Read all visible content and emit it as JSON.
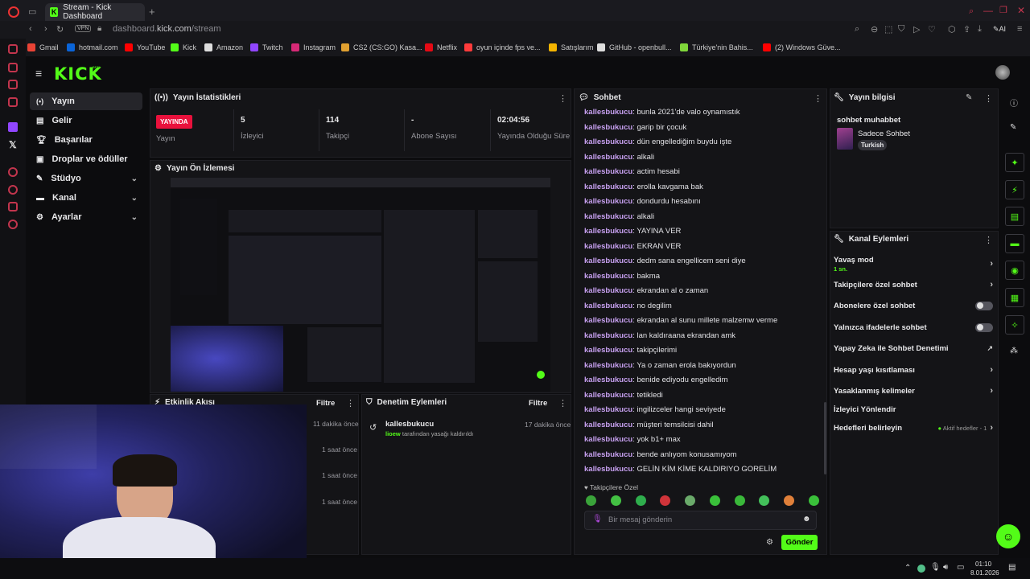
{
  "browser": {
    "tab_title": "Stream - Kick Dashboard",
    "vpn_label": "VPN",
    "url_prefix": "dashboard.",
    "url_domain": "kick.com",
    "url_path": "/stream",
    "ai_label": "AI",
    "bookmarks": [
      {
        "label": "Gmail",
        "color": "#ea4335"
      },
      {
        "label": "hotmail.com",
        "color": "#0a64d8"
      },
      {
        "label": "YouTube",
        "color": "#ff0000"
      },
      {
        "label": "Kick",
        "color": "#53fc18"
      },
      {
        "label": "Amazon",
        "color": "#dddddd"
      },
      {
        "label": "Twitch",
        "color": "#9146ff"
      },
      {
        "label": "Instagram",
        "color": "#d62976"
      },
      {
        "label": "CS2 (CS:GO) Kasa...",
        "color": "#e0a030"
      },
      {
        "label": "Netflix",
        "color": "#e50914"
      },
      {
        "label": "oyun içinde fps ve...",
        "color": "#ff3b3b"
      },
      {
        "label": "Satışlarım",
        "color": "#f4b400"
      },
      {
        "label": "GitHub - openbull...",
        "color": "#dddddd"
      },
      {
        "label": "Türkiye'nin Bahis...",
        "color": "#7fd63a"
      },
      {
        "label": "(2) Windows Güve...",
        "color": "#ff0000"
      }
    ]
  },
  "brand": {
    "logo": "KICK",
    "beta": "BETA"
  },
  "nav": [
    {
      "label": "Yayın"
    },
    {
      "label": "Gelir"
    },
    {
      "label": "Başarılar"
    },
    {
      "label": "Droplar ve ödüller"
    },
    {
      "label": "Stüdyo"
    },
    {
      "label": "Kanal"
    },
    {
      "label": "Ayarlar"
    }
  ],
  "stats": {
    "title": "Yayın İstatistikleri",
    "live_badge": "YAYINDA",
    "live_label": "Yayın",
    "items": [
      {
        "value": "5",
        "label": "İzleyici"
      },
      {
        "value": "114",
        "label": "Takipçi"
      },
      {
        "value": "-",
        "label": "Abone Sayısı"
      },
      {
        "value": "02:04:56",
        "label": "Yayında Olduğu Süre"
      }
    ]
  },
  "preview": {
    "title": "Yayın Ön İzlemesi"
  },
  "activity": {
    "title": "Etkinlik Akışı",
    "filter": "Filtre",
    "times": [
      "11 dakika önce",
      "1 saat önce",
      "1 saat önce",
      "1 saat önce"
    ]
  },
  "mod": {
    "title": "Denetim Eylemleri",
    "filter": "Filtre",
    "entry": {
      "user": "kallesbukucu",
      "time": "17 dakika önce",
      "actor": "lioew",
      "action": "tarafından yasağı kaldırıldı"
    }
  },
  "chat": {
    "title": "Sohbet",
    "messages": [
      {
        "user": "kallesbukucu",
        "text": "bunla 2021'de valo oynamıstık"
      },
      {
        "user": "kallesbukucu",
        "text": "garip bir çocuk"
      },
      {
        "user": "kallesbukucu",
        "text": "dün engellediğim buydu işte"
      },
      {
        "user": "kallesbukucu",
        "text": "alkali"
      },
      {
        "user": "kallesbukucu",
        "text": "actim hesabi"
      },
      {
        "user": "kallesbukucu",
        "text": "erolla kavgama bak"
      },
      {
        "user": "kallesbukucu",
        "text": "dondurdu hesabını"
      },
      {
        "user": "kallesbukucu",
        "text": "alkali"
      },
      {
        "user": "kallesbukucu",
        "text": "YAYINA VER"
      },
      {
        "user": "kallesbukucu",
        "text": "EKRAN VER"
      },
      {
        "user": "kallesbukucu",
        "text": "dedm sana engellicem seni diye"
      },
      {
        "user": "kallesbukucu",
        "text": "bakma"
      },
      {
        "user": "kallesbukucu",
        "text": "ekrandan al o zaman"
      },
      {
        "user": "kallesbukucu",
        "text": "no degilim"
      },
      {
        "user": "kallesbukucu",
        "text": "ekrandan al sunu millete malzemw verme"
      },
      {
        "user": "kallesbukucu",
        "text": "lan kaldıraana ekrandan amk"
      },
      {
        "user": "kallesbukucu",
        "text": "takipçilerimi"
      },
      {
        "user": "kallesbukucu",
        "text": "Ya o zaman erola bakıyordun"
      },
      {
        "user": "kallesbukucu",
        "text": "benide ediyodu engelledim"
      },
      {
        "user": "kallesbukucu",
        "text": "tetikledi"
      },
      {
        "user": "kallesbukucu",
        "text": "ingilizceler hangi seviyede"
      },
      {
        "user": "kallesbukucu",
        "text": "müşteri temsilcisi dahil"
      },
      {
        "user": "kallesbukucu",
        "text": "yok b1+ max"
      },
      {
        "user": "kallesbukucu",
        "text": "bende anlıyom konusamıyom"
      },
      {
        "user": "kallesbukucu",
        "text": "GELİN KİM KİME KALDIRIYO GORELİM"
      }
    ],
    "followers_only": "Takipçilere Özel",
    "input_placeholder": "Bir mesaj gönderin",
    "send": "Gönder"
  },
  "stream_info": {
    "title": "Yayın bilgisi",
    "stream_title": "sohbet muhabbet",
    "category": "Sadece Sohbet",
    "tag": "Turkish"
  },
  "channel_actions": {
    "title": "Kanal Eylemleri",
    "slow_mode": "Yavaş mod",
    "slow_value": "1 sn.",
    "items": [
      {
        "label": "Takipçilere özel sohbet",
        "control": "arrow"
      },
      {
        "label": "Abonelere özel sohbet",
        "control": "toggle"
      },
      {
        "label": "Yalnızca ifadelerle sohbet",
        "control": "toggle"
      },
      {
        "label": "Yapay Zeka ile Sohbet Denetimi",
        "control": "external"
      },
      {
        "label": "Hesap yaşı kısıtlaması",
        "control": "arrow"
      },
      {
        "label": "Yasaklanmış kelimeler",
        "control": "arrow"
      },
      {
        "label": "İzleyici Yönlendir",
        "control": "none"
      },
      {
        "label": "Hedefleri belirleyin",
        "control": "arrow"
      }
    ],
    "goals_status": "Aktif hedefler - 1"
  },
  "taskbar": {
    "time": "01:10",
    "date": "8.01.2026"
  },
  "colors": {
    "accent": "#53fc18",
    "live": "#e9113c",
    "username": "#c7a0f0"
  }
}
